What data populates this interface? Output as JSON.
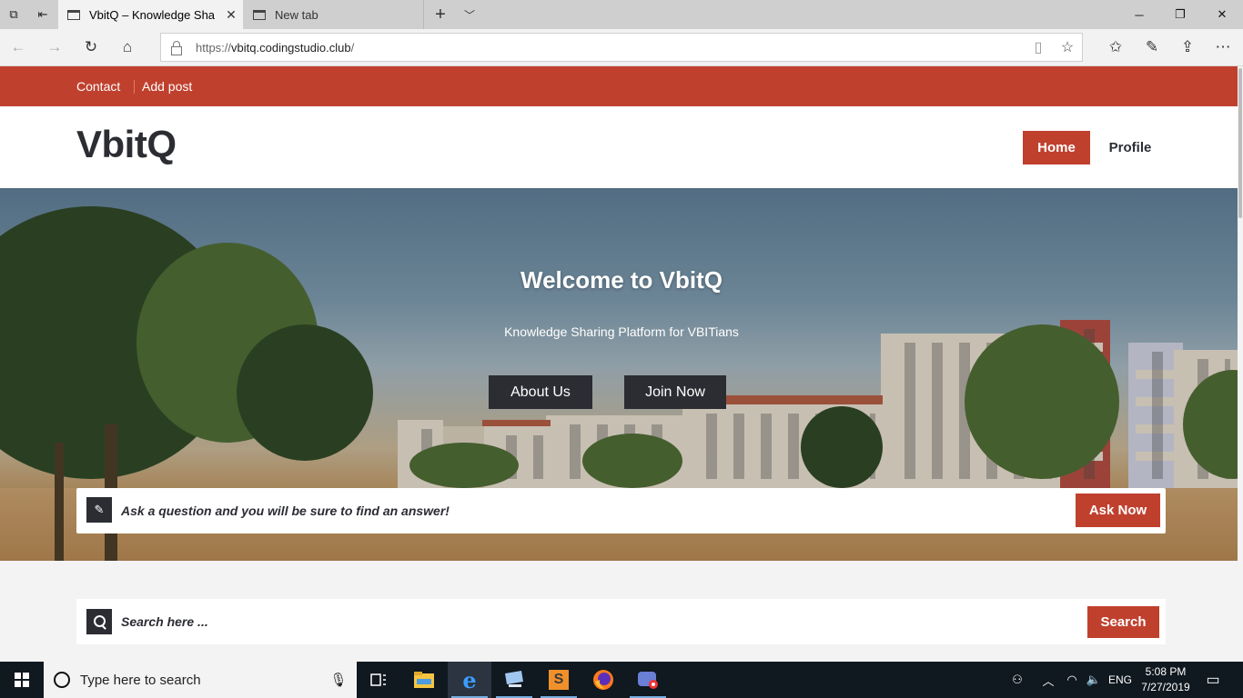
{
  "browser": {
    "tabs": [
      {
        "title": "VbitQ – Knowledge Sha",
        "active": true
      },
      {
        "title": "New tab",
        "active": false
      }
    ],
    "address": {
      "protocol": "https://",
      "domain": "vbitq.codingstudio.club",
      "path": "/"
    }
  },
  "site": {
    "topbar": {
      "links": [
        "Contact",
        "Add post"
      ]
    },
    "logo": "VbitQ",
    "menu": {
      "home": "Home",
      "profile": "Profile"
    },
    "hero": {
      "title": "Welcome to VbitQ",
      "subtitle": "Knowledge Sharing Platform for VBITians",
      "buttons": [
        "About Us",
        "Join Now"
      ]
    },
    "ask": {
      "prompt": "Ask a question and you will be sure to find an answer!",
      "button": "Ask Now"
    },
    "search": {
      "placeholder": "Search here ...",
      "button": "Search"
    },
    "colors": {
      "accent": "#c0402e",
      "dark": "#2b2d33"
    }
  },
  "taskbar": {
    "search_placeholder": "Type here to search",
    "language": "ENG",
    "time": "5:08 PM",
    "date": "7/27/2019"
  }
}
